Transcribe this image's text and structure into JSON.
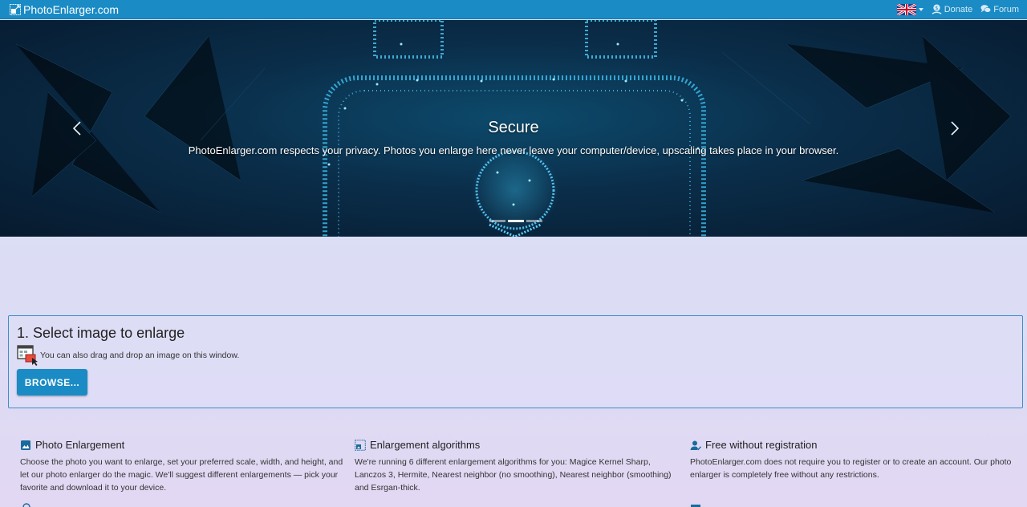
{
  "navbar": {
    "brand": "PhotoEnlarger.com",
    "language_icon": "uk-flag-icon",
    "donate_label": "Donate",
    "forum_label": "Forum"
  },
  "hero": {
    "title": "Secure",
    "text": "PhotoEnlarger.com respects your privacy. Photos you enlarge here never leave your computer/device, upscaling takes place in your browser.",
    "slide_count": 3,
    "active_slide": 2
  },
  "select": {
    "title": "1. Select image to enlarge",
    "drag_hint": "You can also drag and drop an image on this window.",
    "browse_label": "BROWSE..."
  },
  "features": [
    {
      "icon": "image-icon",
      "title": "Photo Enlargement",
      "text": "Choose the photo you want to enlarge, set your preferred scale, width, and height, and let our photo enlarger do the magic. We'll suggest different enlargements — pick your favorite and download it to your device."
    },
    {
      "icon": "enlarge-icon",
      "title": "Enlargement algorithms",
      "text": "We're running 6 different enlargement algorithms for you: Magice Kernel Sharp, Lanczos 3, Hermite, Nearest neighbor (no smoothing), Nearest neighbor (smoothing) and Esrgan-thick."
    },
    {
      "icon": "user-check-icon",
      "title": "Free without registration",
      "text": "PhotoEnlarger.com does not require you to register or to create an account. Our photo enlarger is completely free without any restrictions."
    }
  ],
  "colors": {
    "navbar": "#1a8bc4",
    "button": "#1a8bc4",
    "panel_border": "#3d8fc4"
  }
}
